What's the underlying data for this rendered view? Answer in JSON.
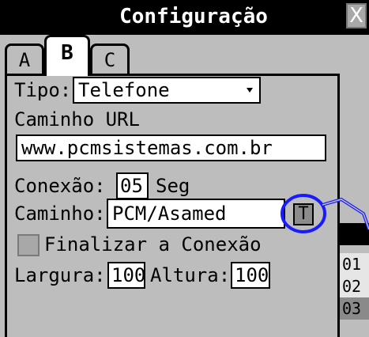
{
  "window": {
    "title": "Configuração",
    "close_label": "X"
  },
  "tabs": [
    {
      "label": "A",
      "active": false
    },
    {
      "label": "B",
      "active": true
    },
    {
      "label": "C",
      "active": false
    }
  ],
  "form": {
    "tipo_label": "Tipo:",
    "tipo_value": "Telefone",
    "caminho_url_label": "Caminho URL",
    "url_value": "www.pcmsistemas.com.br",
    "conexao_label": "Conexão:",
    "conexao_value": "05",
    "conexao_unit": "Seg",
    "caminho_label": "Caminho:",
    "caminho_value": "PCM/Asamed",
    "caminho_button_label": "T",
    "finalizar_label": "Finalizar a Conexão",
    "finalizar_checked": false,
    "largura_label": "Largura:",
    "largura_value": "100",
    "altura_label": "Altura:",
    "altura_value": "100"
  },
  "side_list": {
    "rows": [
      "01",
      "02",
      "03"
    ]
  },
  "colors": {
    "annotation": "#1a1aff",
    "background": "#bdbdbd"
  }
}
